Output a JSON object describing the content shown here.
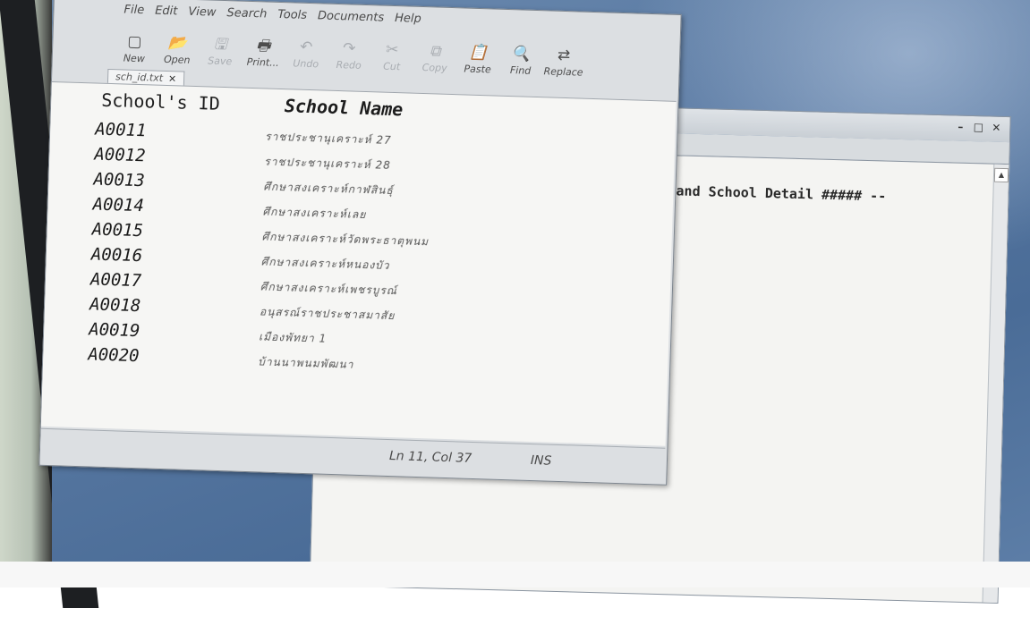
{
  "editor": {
    "menu": [
      "File",
      "Edit",
      "View",
      "Search",
      "Tools",
      "Documents",
      "Help"
    ],
    "toolbar": [
      {
        "label": "New",
        "icon": "new-document-icon",
        "glyph": "▢",
        "enabled": true
      },
      {
        "label": "Open",
        "icon": "open-folder-icon",
        "glyph": "📂",
        "enabled": true
      },
      {
        "label": "Save",
        "icon": "save-icon",
        "glyph": "🖫",
        "enabled": false
      },
      {
        "label": "Print...",
        "icon": "print-icon",
        "glyph": "🖶",
        "enabled": true
      },
      {
        "label": "Undo",
        "icon": "undo-icon",
        "glyph": "↶",
        "enabled": false
      },
      {
        "label": "Redo",
        "icon": "redo-icon",
        "glyph": "↷",
        "enabled": false
      },
      {
        "label": "Cut",
        "icon": "cut-icon",
        "glyph": "✂",
        "enabled": false
      },
      {
        "label": "Copy",
        "icon": "copy-icon",
        "glyph": "⧉",
        "enabled": false
      },
      {
        "label": "Paste",
        "icon": "paste-icon",
        "glyph": "📋",
        "enabled": true
      },
      {
        "label": "Find",
        "icon": "find-icon",
        "glyph": "🔍",
        "enabled": true
      },
      {
        "label": "Replace",
        "icon": "replace-icon",
        "glyph": "⇄",
        "enabled": true
      }
    ],
    "tab": {
      "label": "sch_id.txt",
      "close": "×"
    },
    "header": {
      "id": "School's ID",
      "name": "School Name"
    },
    "rows": [
      {
        "id": "A0011",
        "name": "ราชประชานุเคราะห์ 27"
      },
      {
        "id": "A0012",
        "name": "ราชประชานุเคราะห์ 28"
      },
      {
        "id": "A0013",
        "name": "ศึกษาสงเคราะห์กาฬสินธุ์"
      },
      {
        "id": "A0014",
        "name": "ศึกษาสงเคราะห์เลย"
      },
      {
        "id": "A0015",
        "name": "ศึกษาสงเคราะห์วัดพระธาตุพนม"
      },
      {
        "id": "A0016",
        "name": "ศึกษาสงเคราะห์หนองบัว"
      },
      {
        "id": "A0017",
        "name": "ศึกษาสงเคราะห์เพชรบูรณ์"
      },
      {
        "id": "A0018",
        "name": "อนุสรณ์ราชประชาสมาสัย"
      },
      {
        "id": "A0019",
        "name": "เมืองพัทยา 1"
      },
      {
        "id": "A0020",
        "name": "บ้านนาพนมพัฒนา"
      }
    ],
    "status": {
      "position": "Ln 11, Col 37",
      "mode": "INS"
    }
  },
  "back_window": {
    "controls": [
      "–",
      "□",
      "✕"
    ],
    "text": "on and School Detail ##### --",
    "scroll_up": "▲"
  }
}
